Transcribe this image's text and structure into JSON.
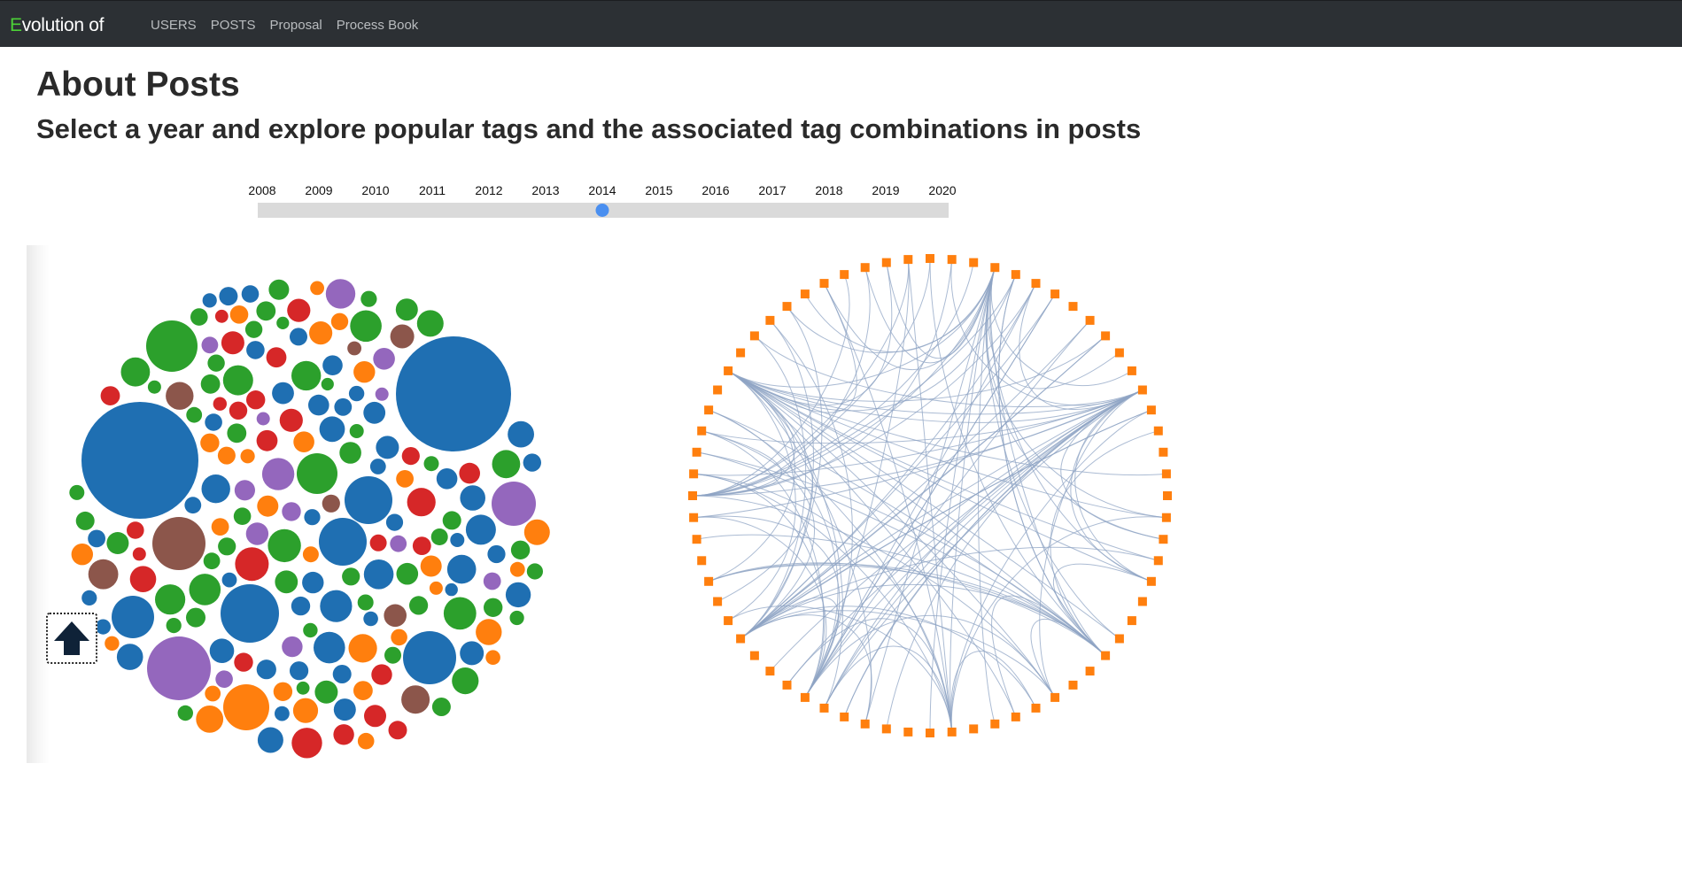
{
  "navbar": {
    "brand_first_letter": "E",
    "brand_rest": "volution of",
    "links": [
      "USERS",
      "POSTS",
      "Proposal",
      "Process Book"
    ],
    "brand_accent_color": "#4cd137",
    "background_color": "#2c3034"
  },
  "page": {
    "title": "About Posts",
    "subtitle": "Select a year and explore popular tags and the associated tag combinations in posts"
  },
  "year_slider": {
    "years": [
      "2008",
      "2009",
      "2010",
      "2011",
      "2012",
      "2013",
      "2014",
      "2015",
      "2016",
      "2017",
      "2018",
      "2019",
      "2020"
    ],
    "selected_year": "2014",
    "handle_color": "#4a8ff0"
  },
  "scroll_button": {
    "icon": "arrow-up-icon"
  },
  "chart_data": [
    {
      "type": "bubble",
      "title": "",
      "colors": [
        "#1f6fb2",
        "#2ca02c",
        "#ff7f0e",
        "#d62728",
        "#9467bd",
        "#8c564b"
      ],
      "bubble_count": 232
    },
    {
      "type": "hierarchical-edge-bundling",
      "title": "",
      "node_count": 68,
      "node_color": "#ff7f0e",
      "edge_color": "#8fa4c4"
    }
  ]
}
